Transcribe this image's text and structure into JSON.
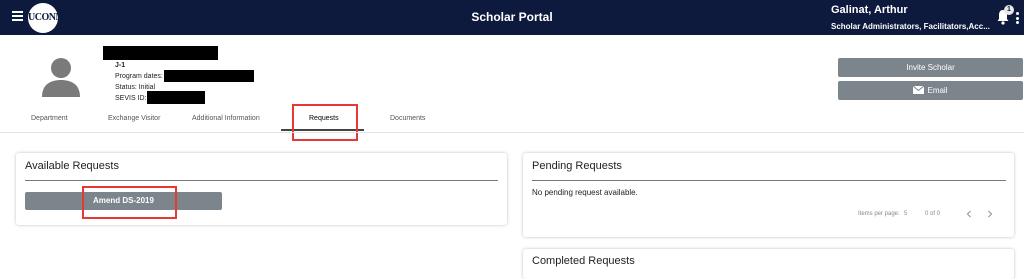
{
  "header": {
    "title": "Scholar Portal",
    "logo_text": "UCONN",
    "user_name": "Galinat, Arthur",
    "user_roles": "Scholar Administrators, Facilitators,Acc...",
    "notification_count": "1"
  },
  "profile": {
    "visa_type": "J-1",
    "program_dates_label": "Program dates:",
    "status_label": "Status: Initial",
    "sevis_label": "SEVIS ID: N"
  },
  "actions": {
    "invite_label": "Invite Scholar",
    "email_label": "Email"
  },
  "tabs": [
    {
      "label": "Department"
    },
    {
      "label": "Exchange Visitor"
    },
    {
      "label": "Additional Information"
    },
    {
      "label": "Requests"
    },
    {
      "label": "Documents"
    }
  ],
  "active_tab": "Requests",
  "available_requests": {
    "title": "Available Requests",
    "buttons": [
      "Amend DS-2019"
    ]
  },
  "pending_requests": {
    "title": "Pending Requests",
    "empty_message": "No pending request available.",
    "items_per_page_label": "Items per page:",
    "items_per_page": "5",
    "range_label": "0 of 0"
  },
  "completed_requests": {
    "title": "Completed Requests"
  },
  "colors": {
    "header_bg": "#0d1a3d",
    "button_bg": "#7d858c",
    "highlight": "#e53935"
  }
}
